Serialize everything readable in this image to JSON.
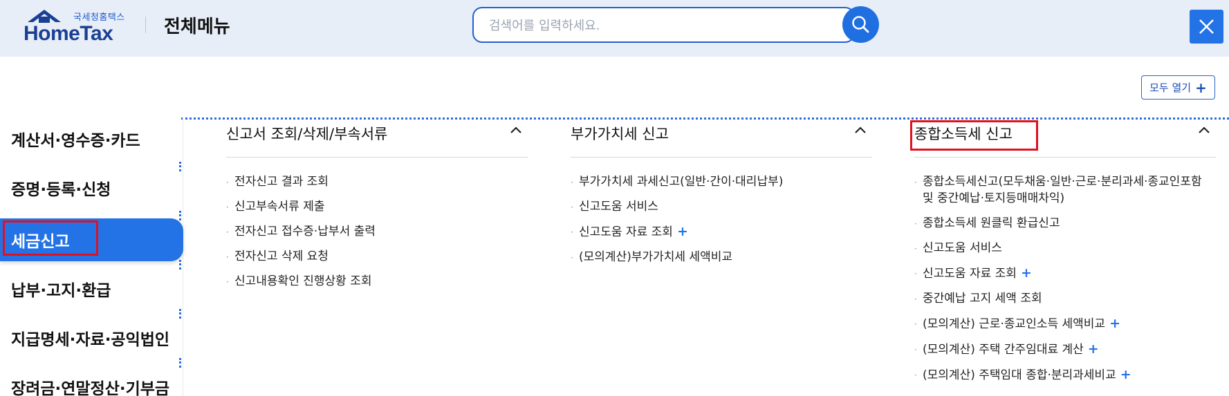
{
  "header": {
    "logo_sub": "국세청홈택스",
    "logo_main": "HomeTax",
    "title": "전체메뉴"
  },
  "search": {
    "placeholder": "검색어를 입력하세요.",
    "value": ""
  },
  "expand_all_label": "모두 열기",
  "sidebar": {
    "items": [
      {
        "label": "계산서·영수증·카드",
        "active": false
      },
      {
        "label": "증명·등록·신청",
        "active": false
      },
      {
        "label": "세금신고",
        "active": true
      },
      {
        "label": "납부·고지·환급",
        "active": false
      },
      {
        "label": "지급명세·자료·공익법인",
        "active": false
      },
      {
        "label": "장려금·연말정산·기부금",
        "active": false
      }
    ]
  },
  "columns": [
    {
      "title": "신고서 조회/삭제/부속서류",
      "items": [
        {
          "label": "전자신고 결과 조회",
          "has_plus": false
        },
        {
          "label": "신고부속서류 제출",
          "has_plus": false
        },
        {
          "label": "전자신고 접수증·납부서 출력",
          "has_plus": false
        },
        {
          "label": "전자신고 삭제 요청",
          "has_plus": false
        },
        {
          "label": "신고내용확인 진행상황 조회",
          "has_plus": false
        }
      ]
    },
    {
      "title": "부가가치세 신고",
      "items": [
        {
          "label": "부가가치세 과세신고(일반·간이·대리납부)",
          "has_plus": false
        },
        {
          "label": "신고도움 서비스",
          "has_plus": false
        },
        {
          "label": "신고도움 자료 조회",
          "has_plus": true
        },
        {
          "label": "(모의계산)부가가치세 세액비교",
          "has_plus": false
        }
      ]
    },
    {
      "title": "종합소득세 신고",
      "items": [
        {
          "label": "종합소득세신고(모두채움·일반·근로·분리과세·종교인포함 및 중간예납·토지등매매차익)",
          "has_plus": false
        },
        {
          "label": "종합소득세 원클릭 환급신고",
          "has_plus": false
        },
        {
          "label": "신고도움 서비스",
          "has_plus": false
        },
        {
          "label": "신고도움 자료 조회",
          "has_plus": true
        },
        {
          "label": "중간예납 고지 세액 조회",
          "has_plus": false
        },
        {
          "label": "(모의계산) 근로·종교인소득 세액비교",
          "has_plus": true
        },
        {
          "label": "(모의계산) 주택 간주임대료 계산",
          "has_plus": true
        },
        {
          "label": "(모의계산) 주택임대 종합·분리과세비교",
          "has_plus": true
        }
      ]
    }
  ],
  "colors": {
    "accent": "#2473e6",
    "header_bg": "#e8eef8",
    "highlight_box": "#e0101e"
  }
}
